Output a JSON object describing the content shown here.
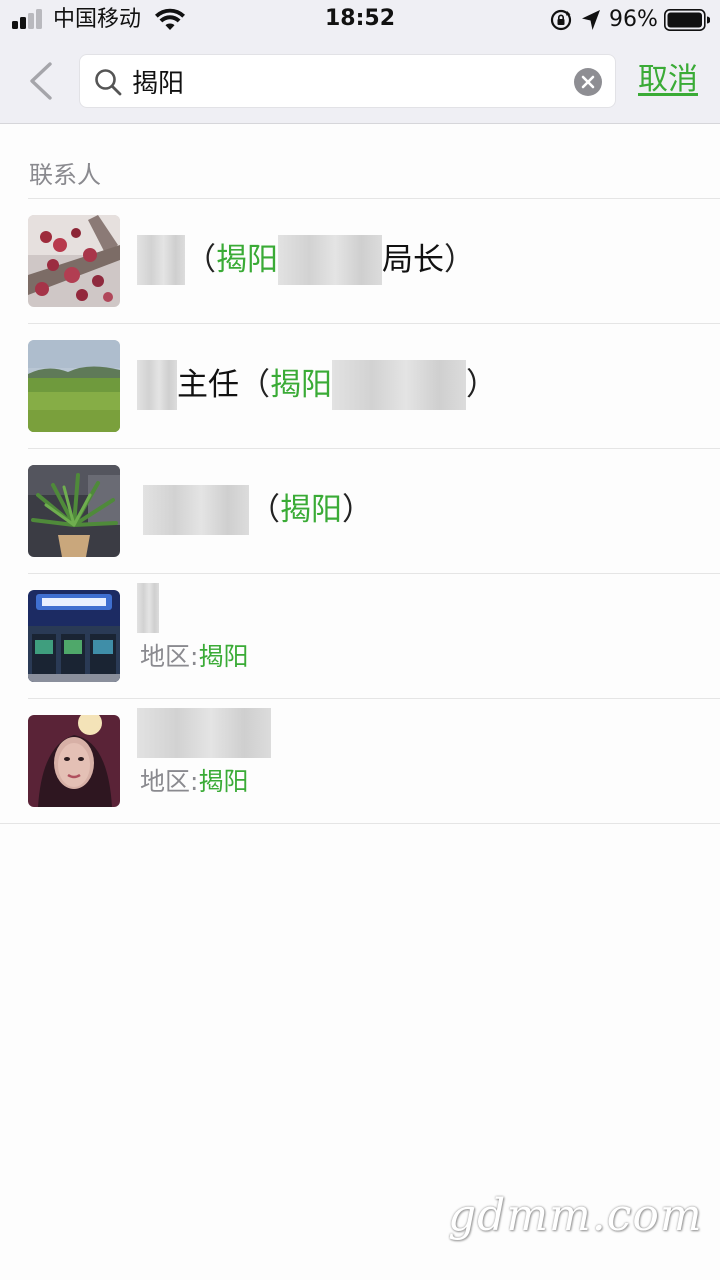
{
  "status_bar": {
    "carrier": "中国移动",
    "time": "18:52",
    "battery_percent": "96%",
    "signal_bars_active": 2,
    "signal_bars_total": 4
  },
  "search": {
    "query": "揭阳",
    "cancel_label": "取消"
  },
  "results": {
    "section_title": "联系人",
    "rows": [
      {
        "avatar": "plum-blossom-photo",
        "paren_open": "（",
        "highlight": "揭阳",
        "title_after": "局长",
        "paren_close": "）"
      },
      {
        "avatar": "green-field-photo",
        "title_before": "主任",
        "paren_open": "（",
        "highlight": "揭阳",
        "paren_close": "）"
      },
      {
        "avatar": "potted-plant-photo",
        "paren_open": "（",
        "highlight": "揭阳",
        "paren_close": "）"
      },
      {
        "avatar": "arcade-photo",
        "sub_prefix": "地区:",
        "sub_highlight": "揭阳"
      },
      {
        "avatar": "woman-portrait-photo",
        "sub_prefix": "地区:",
        "sub_highlight": "揭阳"
      }
    ]
  },
  "watermark": "gdmm.com",
  "colors": {
    "accent_green": "#3aab36",
    "header_bg": "#efeff4",
    "secondary_text": "#8a8a8f"
  }
}
